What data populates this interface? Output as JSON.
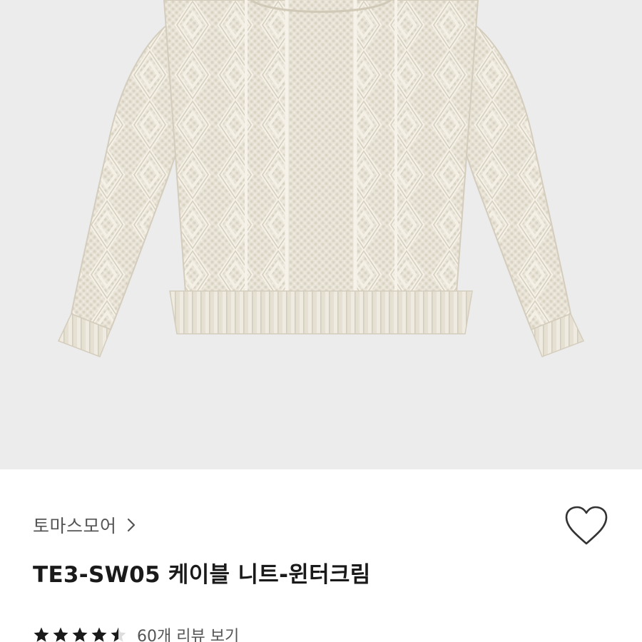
{
  "product": {
    "image_alt": "cream cable knit sweater",
    "brand": "토마스모어",
    "brand_chevron_icon": "chevron-right-icon",
    "wishlist_icon": "heart-outline-icon",
    "title": "TE3-SW05 케이블 니트-윈터크림"
  },
  "rating": {
    "value": 4.5,
    "max": 5,
    "review_link": "60개 리뷰 보기"
  },
  "colors": {
    "hero_background": "#ececec",
    "sweater": "#e9e4d8",
    "star": "#1a1a1a",
    "text_primary": "#1a1a1a",
    "text_secondary": "#555555"
  }
}
